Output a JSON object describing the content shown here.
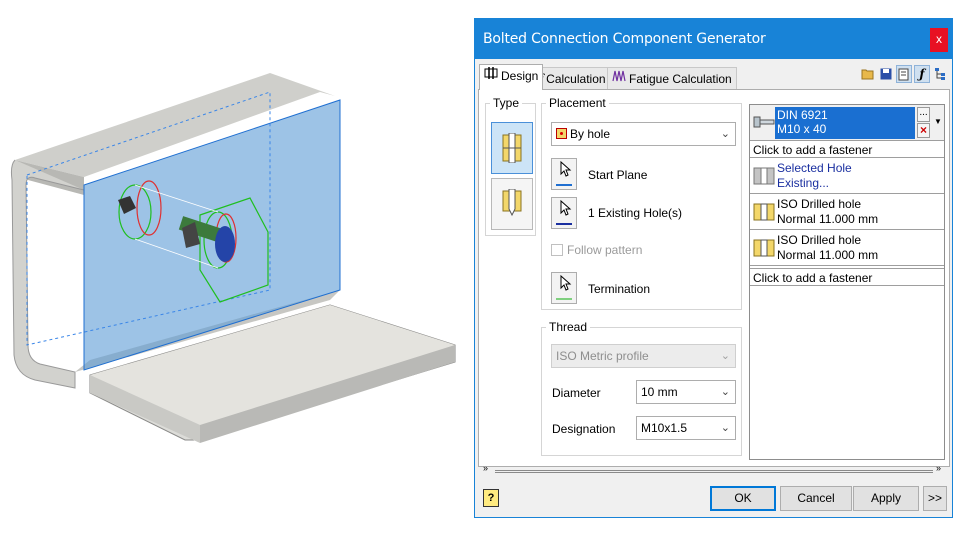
{
  "dialog": {
    "title": "Bolted Connection Component Generator",
    "close_label": "x",
    "accent_color": "#1883d7"
  },
  "tabs": [
    {
      "label": "Design",
      "icon": "bolt-design-icon",
      "active": true
    },
    {
      "label": "Calculation",
      "icon": "function-icon",
      "active": false
    },
    {
      "label": "Fatigue Calculation",
      "icon": "fatigue-graph-icon",
      "active": false
    }
  ],
  "toolbar_icons": [
    "open-folder-icon",
    "save-icon",
    "notes-icon",
    "function-icon",
    "tree-icon"
  ],
  "type_group": {
    "legend": "Type",
    "options": [
      {
        "name": "through-all-bolt-icon",
        "selected": true
      },
      {
        "name": "blind-bolt-icon",
        "selected": false
      }
    ]
  },
  "placement": {
    "legend": "Placement",
    "method": "By hole",
    "start_plane_label": "Start Plane",
    "existing_holes_label": "1 Existing Hole(s)",
    "follow_pattern_label": "Follow pattern",
    "termination_label": "Termination"
  },
  "thread": {
    "legend": "Thread",
    "profile": "ISO Metric profile",
    "diameter_label": "Diameter",
    "diameter_value": "10 mm",
    "designation_label": "Designation",
    "designation_value": "M10x1.5"
  },
  "fasteners": {
    "bolt_line1": "DIN 6921",
    "bolt_line2": "M10 x 40",
    "add_top": "Click to add a fastener",
    "items": [
      {
        "line1": "Selected Hole",
        "line2": "Existing...",
        "icon": "existing-hole-icon"
      },
      {
        "line1": "ISO Drilled hole",
        "line2": "Normal 11.000 mm",
        "icon": "drilled-hole-icon"
      },
      {
        "line1": "ISO Drilled hole",
        "line2": "Normal 11.000 mm",
        "icon": "drilled-hole-icon"
      }
    ],
    "add_bottom": "Click to add a fastener",
    "browse_label": "...",
    "remove_label": "×"
  },
  "footer": {
    "ok": "OK",
    "cancel": "Cancel",
    "apply": "Apply",
    "more": ">>",
    "help": "?"
  }
}
